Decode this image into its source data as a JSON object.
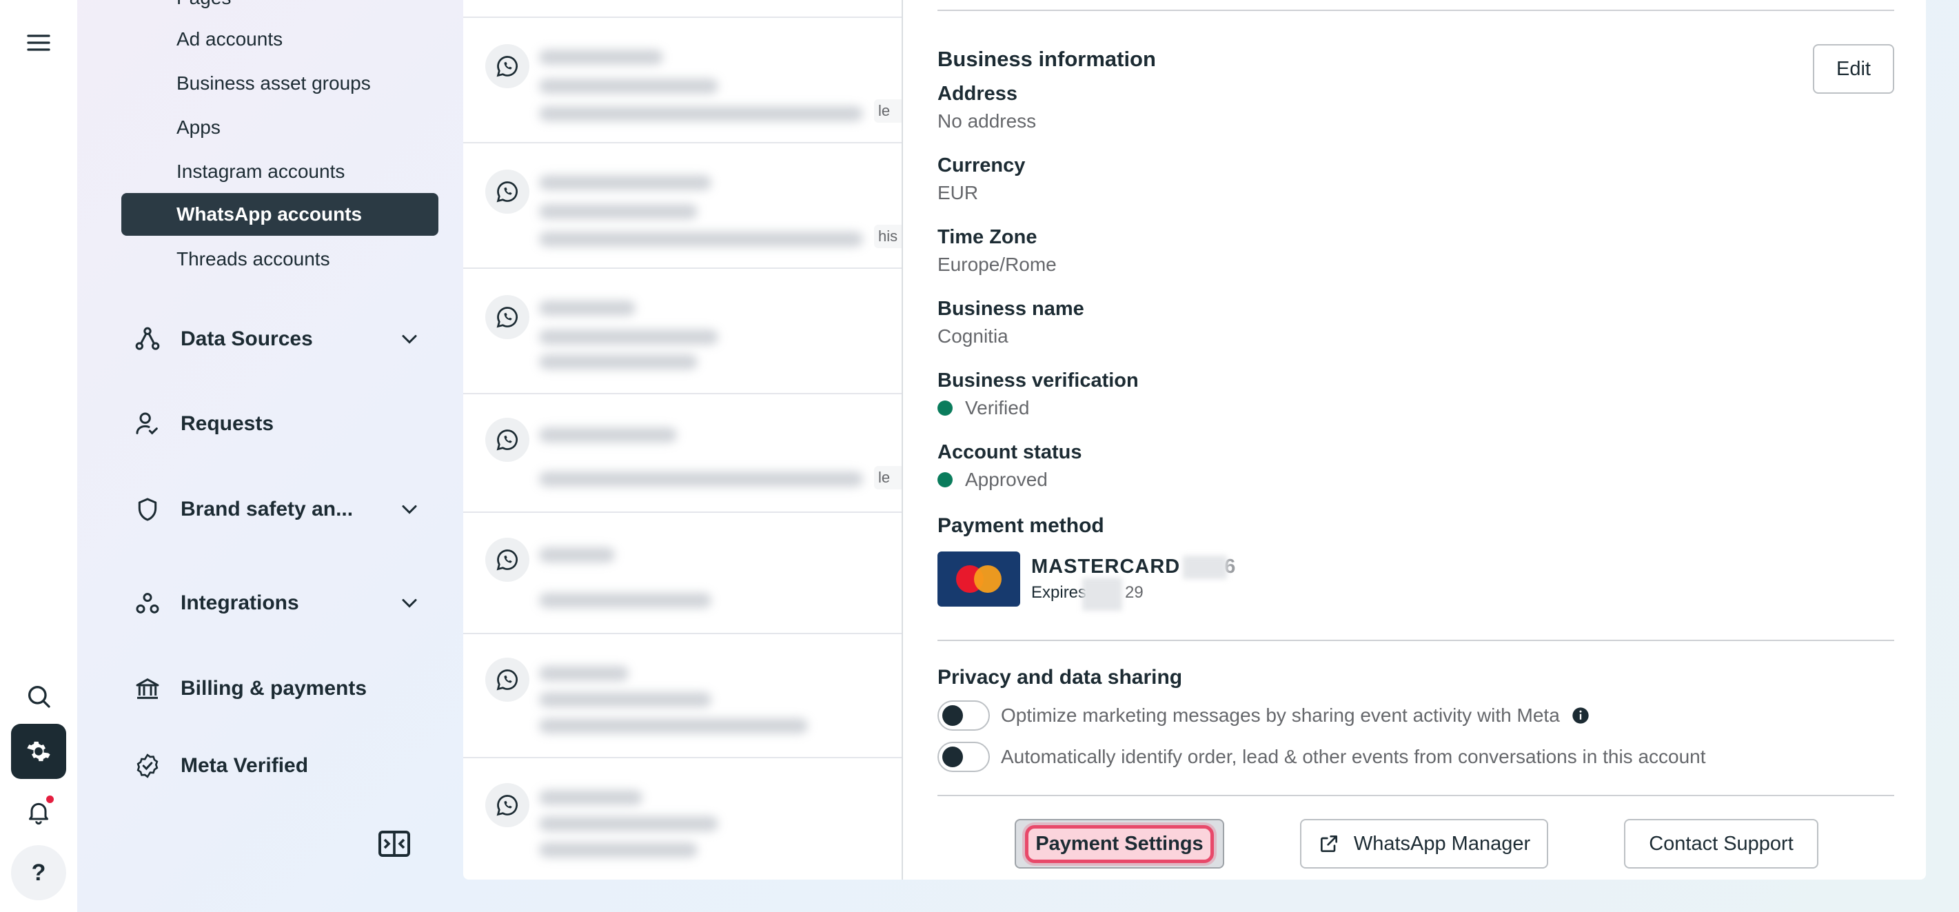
{
  "rail": {
    "menu_icon": "hamburger-icon",
    "search_icon": "search-icon",
    "settings_icon": "gear-icon",
    "notifications_icon": "bell-icon",
    "help_label": "?"
  },
  "sidebar": {
    "partial_top_label": "Pages",
    "sub_items": [
      {
        "label": "Ad accounts"
      },
      {
        "label": "Business asset groups"
      },
      {
        "label": "Apps"
      },
      {
        "label": "Instagram accounts"
      },
      {
        "label": "WhatsApp accounts",
        "selected": true
      },
      {
        "label": "Threads accounts"
      }
    ],
    "nav_items": [
      {
        "label": "Data Sources",
        "icon": "data-sources-icon",
        "expandable": true
      },
      {
        "label": "Requests",
        "icon": "requests-icon",
        "expandable": false
      },
      {
        "label": "Brand safety an...",
        "icon": "shield-icon",
        "expandable": true
      },
      {
        "label": "Integrations",
        "icon": "integrations-icon",
        "expandable": true
      },
      {
        "label": "Billing & payments",
        "icon": "bank-icon",
        "expandable": false
      },
      {
        "label": "Meta Verified",
        "icon": "verified-badge-icon",
        "expandable": false
      }
    ]
  },
  "list": {
    "row_tails": [
      "le e",
      "his",
      "",
      "le e",
      "",
      "",
      ""
    ]
  },
  "detail": {
    "business_info_title": "Business information",
    "edit_label": "Edit",
    "fields": {
      "address_label": "Address",
      "address_value": "No address",
      "currency_label": "Currency",
      "currency_value": "EUR",
      "timezone_label": "Time Zone",
      "timezone_value": "Europe/Rome",
      "business_name_label": "Business name",
      "business_name_value": "Cognitia",
      "verification_label": "Business verification",
      "verification_value": "Verified",
      "account_status_label": "Account status",
      "account_status_value": "Approved"
    },
    "payment": {
      "title": "Payment method",
      "card_brand": "MASTERCARD",
      "card_last_digit": "6",
      "expires_label": "Expires",
      "expires_tail": "29"
    },
    "privacy": {
      "title": "Privacy and data sharing",
      "toggle1_label": "Optimize marketing messages by sharing event activity with Meta",
      "toggle2_label": "Automatically identify order, lead & other events from conversations in this account"
    },
    "buttons": {
      "payment_settings": "Payment Settings",
      "whatsapp_manager": "WhatsApp Manager",
      "contact_support": "Contact Support"
    }
  },
  "colors": {
    "selected_bg": "#2b3a44",
    "status_green": "#0a7c5c",
    "focus_ring": "#e8496a",
    "mastercard_bg": "#173a6e"
  }
}
